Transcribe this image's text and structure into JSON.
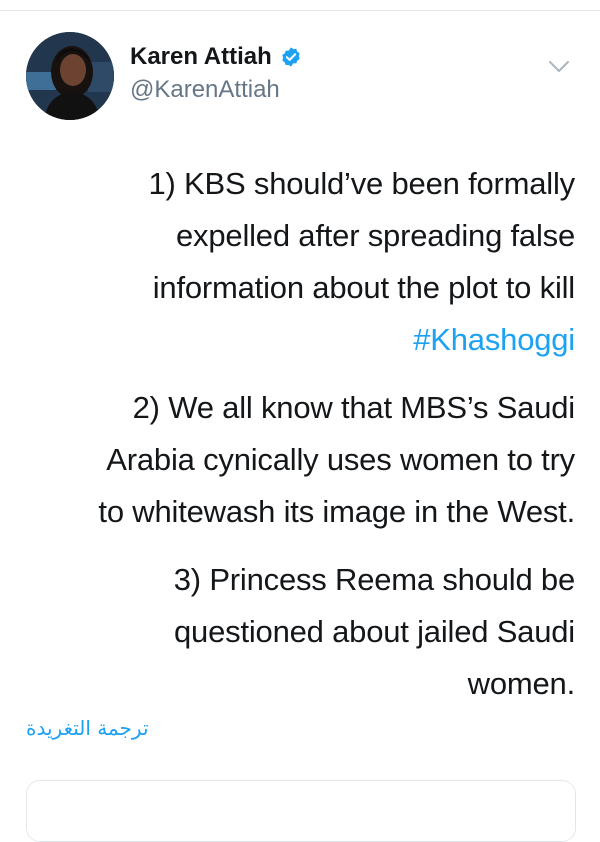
{
  "tweet": {
    "author": {
      "display_name": "Karen Attiah",
      "handle": "@KarenAttiah",
      "verified": true
    },
    "paragraphs": [
      {
        "lines": [
          "1) KBS should’ve been formally",
          "expelled after spreading false",
          "information about the plot to kill"
        ],
        "hashtag": "#Khashoggi"
      },
      {
        "lines": [
          "2) We all know that MBS’s Saudi",
          "Arabia cynically uses women to try",
          "to whitewash its image in the West."
        ]
      },
      {
        "lines": [
          "3) Princess Reema should be",
          "questioned about jailed Saudi",
          "women."
        ]
      }
    ],
    "translate_label": "ترجمة التغريدة"
  },
  "icons": {
    "verified": "verified-badge-icon",
    "menu": "chevron-down-icon"
  },
  "colors": {
    "link": "#1da1f2",
    "text": "#14171a",
    "secondary": "#657786",
    "border": "#e1e8ed"
  }
}
